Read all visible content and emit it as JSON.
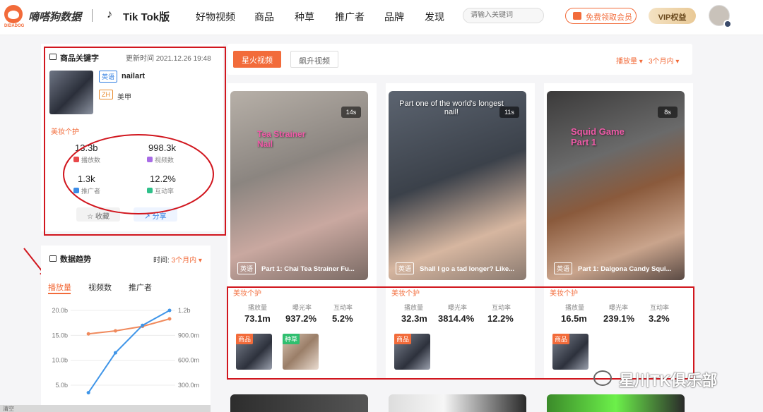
{
  "header": {
    "logo_sub": "DIDADOG",
    "brand": "嘀嗒狗数据",
    "platform": "Tik Tok版",
    "nav": [
      "好物视频",
      "商品",
      "种草",
      "推广者",
      "品牌",
      "发现"
    ],
    "search_placeholder": "请输入关键词",
    "free_vip": "免费领取会员",
    "vip": "VIP权益"
  },
  "keyword_card": {
    "title": "商品关键字",
    "updated": "更新时间 2021.12.26 19:48",
    "en_tag": "英语",
    "en_word": "nailart",
    "zh_tag": "ZH",
    "zh_word": "美甲",
    "category": "美妆个护",
    "stats": [
      {
        "value": "13.3b",
        "label": "播放数",
        "color": "#e8484a"
      },
      {
        "value": "998.3k",
        "label": "视频数",
        "color": "#a86be6"
      },
      {
        "value": "1.3k",
        "label": "推广者",
        "color": "#3b8de8"
      },
      {
        "value": "12.2%",
        "label": "互动率",
        "color": "#2fc08a"
      }
    ],
    "fav": "收藏",
    "share": "分享"
  },
  "trend": {
    "title": "数据趋势",
    "time_label": "时间:",
    "time_value": "3个月内",
    "tabs": [
      "播放量",
      "视频数",
      "推广者"
    ],
    "active_tab": 0,
    "bottom_text": "清空"
  },
  "chart_data": {
    "type": "line",
    "title": "",
    "y_left_ticks": [
      "20.0b",
      "15.0b",
      "10.0b",
      "5.0b"
    ],
    "y_right_ticks": [
      "1.2b",
      "900.0m",
      "600.0m",
      "300.0m"
    ],
    "ylim_left": [
      5,
      20
    ],
    "series": [
      {
        "color": "#f08a5d",
        "axis": "left",
        "values": [
          15.3,
          15.9,
          16.8,
          18.3
        ]
      },
      {
        "color": "#3f95e8",
        "axis": "left",
        "values": [
          3.5,
          11.5,
          17.0,
          20.0
        ]
      }
    ],
    "x": [
      1,
      2,
      3,
      4
    ],
    "x_span": [
      0.5,
      4.0
    ],
    "grid": true
  },
  "filters": {
    "hot": "星火视频",
    "rise": "飙升视频",
    "sort1": "播放量",
    "sort2": "3个月内"
  },
  "videos": [
    {
      "duration": "14s",
      "lang": "英语",
      "caption": "Part 1: Chai Tea Strainer Fu...",
      "overlay": "Tea Strainer Nail",
      "category": "美妆个护",
      "metric_labels": [
        "播放量",
        "曝光率",
        "互动率"
      ],
      "metrics": [
        "73.1m",
        "937.2%",
        "5.2%"
      ],
      "products": [
        {
          "tag": "商品",
          "tag_color": "#f26b3a"
        },
        {
          "tag": "种草",
          "tag_color": "#2fbf6f"
        }
      ]
    },
    {
      "duration": "11s",
      "lang": "英语",
      "caption": "Shall I go a tad longer? Like...",
      "overlay": "Part one of the world's longest nail!",
      "category": "美妆个护",
      "metric_labels": [
        "播放量",
        "曝光率",
        "互动率"
      ],
      "metrics": [
        "32.3m",
        "3814.4%",
        "12.2%"
      ],
      "products": [
        {
          "tag": "商品",
          "tag_color": "#f26b3a"
        }
      ]
    },
    {
      "duration": "8s",
      "lang": "英语",
      "caption": "Part 1: Dalgona Candy Squi...",
      "overlay": "Squid Game Part 1",
      "category": "美妆个护",
      "metric_labels": [
        "播放量",
        "曝光率",
        "互动率"
      ],
      "metrics": [
        "16.5m",
        "239.1%",
        "3.2%"
      ],
      "products": [
        {
          "tag": "商品",
          "tag_color": "#f26b3a"
        }
      ]
    }
  ],
  "watermark": "星川TK俱乐部",
  "colors": {
    "accent": "#f26b3a",
    "annotation": "#d1161e"
  }
}
